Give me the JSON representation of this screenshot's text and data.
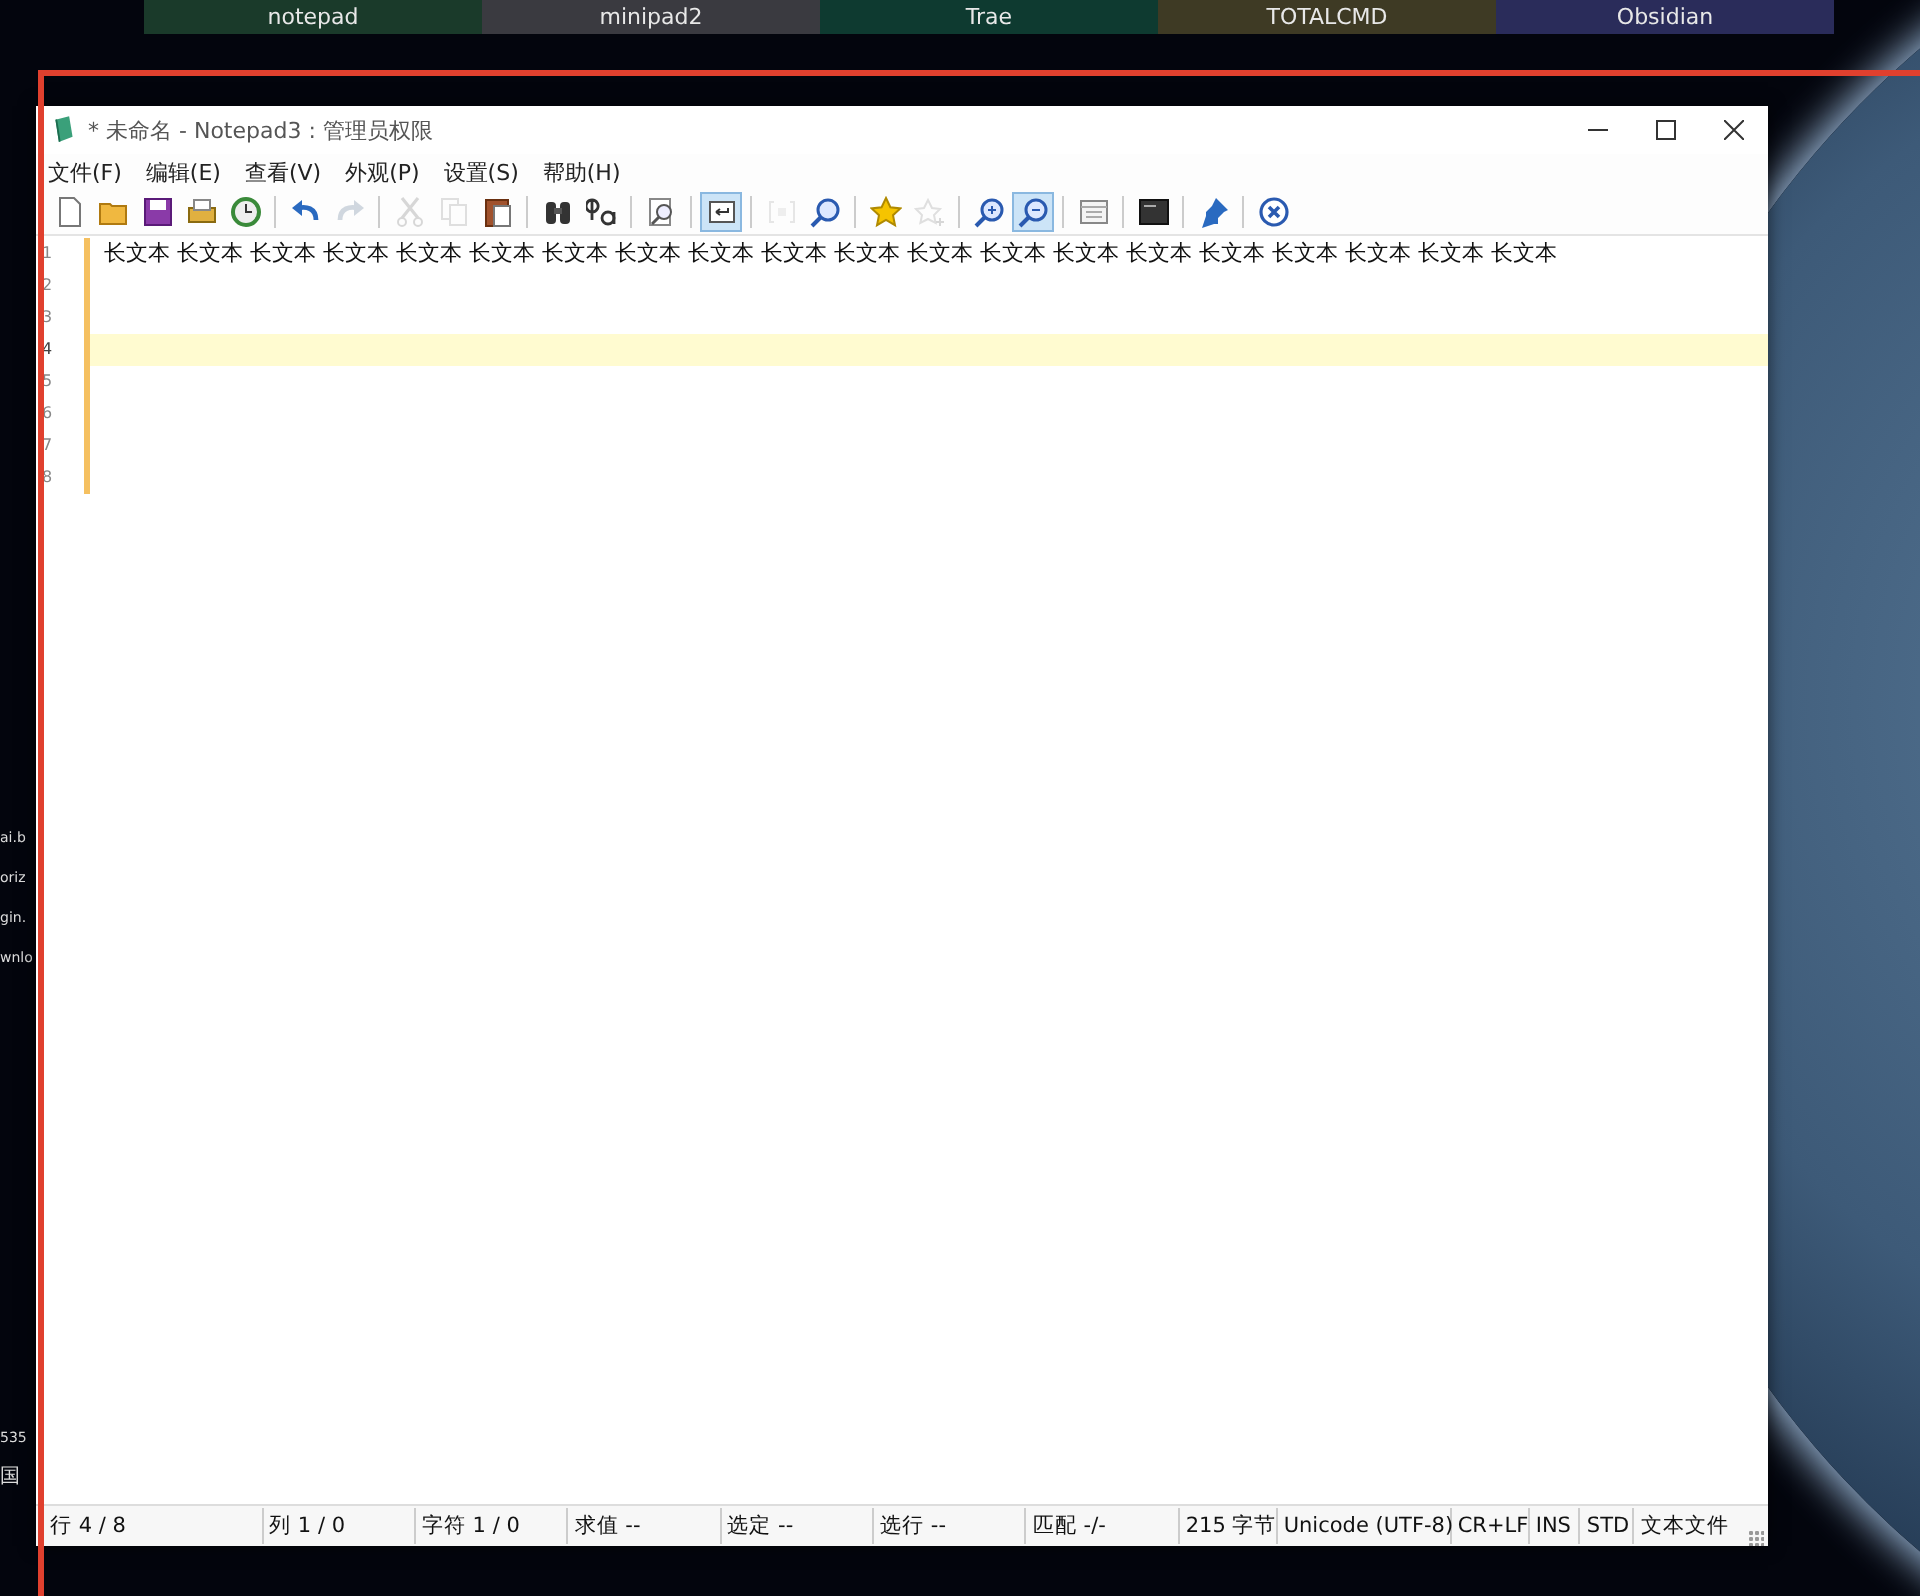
{
  "taskbar": [
    {
      "label": "notepad",
      "color": "#1a3a2a"
    },
    {
      "label": "minipad2",
      "color": "#3a3a40"
    },
    {
      "label": "Trae",
      "color": "#0e3a30"
    },
    {
      "label": "TOTALCMD",
      "color": "#3e3a24"
    },
    {
      "label": "Obsidian",
      "color": "#2a2c5a"
    }
  ],
  "background_fragments": [
    "ai.b",
    "oriz",
    "gin.",
    "wnlo",
    "535",
    "国"
  ],
  "window": {
    "title": "* 未命名 - Notepad3 : 管理员权限"
  },
  "menu": [
    "文件(F)",
    "编辑(E)",
    "查看(V)",
    "外观(P)",
    "设置(S)",
    "帮助(H)"
  ],
  "toolbar": [
    {
      "kind": "new",
      "selected": false,
      "disabled": false
    },
    {
      "kind": "open",
      "selected": false,
      "disabled": false
    },
    {
      "kind": "save",
      "selected": false,
      "disabled": false
    },
    {
      "kind": "saveas",
      "selected": false,
      "disabled": false
    },
    {
      "kind": "revert",
      "selected": false,
      "disabled": false
    },
    {
      "kind": "sep"
    },
    {
      "kind": "undo",
      "selected": false,
      "disabled": false
    },
    {
      "kind": "redo",
      "selected": false,
      "disabled": true
    },
    {
      "kind": "sep"
    },
    {
      "kind": "cut",
      "selected": false,
      "disabled": true
    },
    {
      "kind": "copy",
      "selected": false,
      "disabled": true
    },
    {
      "kind": "paste",
      "selected": false,
      "disabled": false
    },
    {
      "kind": "sep"
    },
    {
      "kind": "find",
      "selected": false,
      "disabled": false
    },
    {
      "kind": "replace",
      "selected": false,
      "disabled": false
    },
    {
      "kind": "sep"
    },
    {
      "kind": "goto",
      "selected": false,
      "disabled": false
    },
    {
      "kind": "sep"
    },
    {
      "kind": "wrap",
      "selected": true,
      "disabled": false
    },
    {
      "kind": "sep"
    },
    {
      "kind": "mark",
      "selected": false,
      "disabled": true
    },
    {
      "kind": "findzoom",
      "selected": false,
      "disabled": false
    },
    {
      "kind": "sep"
    },
    {
      "kind": "star",
      "selected": false,
      "disabled": false
    },
    {
      "kind": "addstar",
      "selected": false,
      "disabled": true
    },
    {
      "kind": "sep"
    },
    {
      "kind": "zoomin",
      "selected": false,
      "disabled": false
    },
    {
      "kind": "zoomout",
      "selected": true,
      "disabled": false
    },
    {
      "kind": "sep"
    },
    {
      "kind": "window",
      "selected": false,
      "disabled": false
    },
    {
      "kind": "sep"
    },
    {
      "kind": "terminal",
      "selected": false,
      "disabled": false
    },
    {
      "kind": "sep"
    },
    {
      "kind": "pin",
      "selected": false,
      "disabled": false
    },
    {
      "kind": "sep"
    },
    {
      "kind": "exit",
      "selected": false,
      "disabled": false
    }
  ],
  "editor": {
    "lines": [
      {
        "number": "1",
        "text": "长文本 长文本 长文本 长文本 长文本 长文本 长文本 长文本 长文本 长文本 长文本 长文本 长文本 长文本 长文本 长文本 长文本 长文本 长文本 长文本",
        "selected": false
      },
      {
        "number": "2",
        "selected": false
      },
      {
        "number": "3",
        "selected": false
      },
      {
        "number": "4",
        "selected": true
      },
      {
        "number": "5",
        "selected": false
      },
      {
        "number": "6",
        "selected": false
      },
      {
        "number": "7",
        "selected": false
      },
      {
        "number": "8",
        "selected": false
      }
    ]
  },
  "status_bar": [
    "行 4 / 8",
    "列 1 / 0",
    "字符 1 / 0",
    "求值 --",
    "选定 --",
    "选行 --",
    "匹配 -/-",
    "215 字节",
    "Unicode (UTF-8)",
    "CR+LF",
    "INS",
    "STD",
    "文本文件"
  ]
}
